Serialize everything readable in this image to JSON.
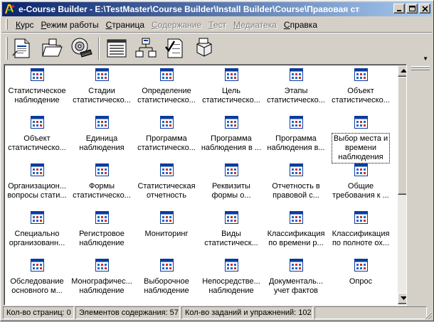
{
  "window": {
    "title": "e-Course Builder - E:\\TestMaster\\Course Builder\\Install Builder\\Course\\Правовая статис..."
  },
  "menu": [
    {
      "underline": "К",
      "rest": "урс",
      "enabled": true
    },
    {
      "underline": "Р",
      "rest": "ежим работы",
      "enabled": true
    },
    {
      "underline": "С",
      "rest": "траница",
      "enabled": true
    },
    {
      "underline": "С",
      "rest": "одержание",
      "enabled": false
    },
    {
      "underline": "Т",
      "rest": "ест",
      "enabled": false
    },
    {
      "underline": "М",
      "rest": "едиатека",
      "enabled": false
    },
    {
      "underline": "С",
      "rest": "правка",
      "enabled": true
    }
  ],
  "toolbar": [
    "new-page-icon",
    "open-folder-icon",
    "cd-drive-icon",
    "window-view-icon",
    "hierarchy-icon",
    "checklist-icon",
    "package-icon"
  ],
  "items": [
    "Статистическое\nнаблюдение",
    "Стадии\nстатистическо...",
    "Определение\nстатистическо...",
    "Цель\nстатистическо...",
    "Этапы\nстатистическо...",
    "Объект\nстатистическо...",
    "Объект\nстатистическо...",
    "Единица\nнаблюдения",
    "Программа\nстатистическо...",
    "Программа\nнаблюдения в ...",
    "Программа\nнаблюдения в...",
    "Выбор места и\nвремени\nнаблюдения",
    "Организацион...\nвопросы стати...",
    "Формы\nстатистическо...",
    "Статистическая\nотчетность",
    "Реквизиты\nформы о...",
    "Отчетность в\nправовой с...",
    "Общие\nтребования к ...",
    "Специально\nорганизованн...",
    "Регистровое\nнаблюдение",
    "Мониторинг",
    "Виды\nстатистическ...",
    "Классификация\nпо времени р...",
    "Классификация\nпо полноте ох...",
    "Обследование\nосновного м...",
    "Монографичес...\nнаблюдение",
    "Выборочное\nнаблюдение",
    "Непосредстве...\nнаблюдение",
    "Документаль...\nучет фактов",
    "Опрос"
  ],
  "selected_index": 11,
  "status": {
    "pages": "Кол-во страниц: 0",
    "elements": "Элементов содержания: 57",
    "tasks": "Кол-во заданий и упражнений: 102"
  },
  "colors": {
    "title_start": "#0a246a",
    "title_end": "#a6caf0",
    "icon_blue": "#0a3c9c"
  }
}
